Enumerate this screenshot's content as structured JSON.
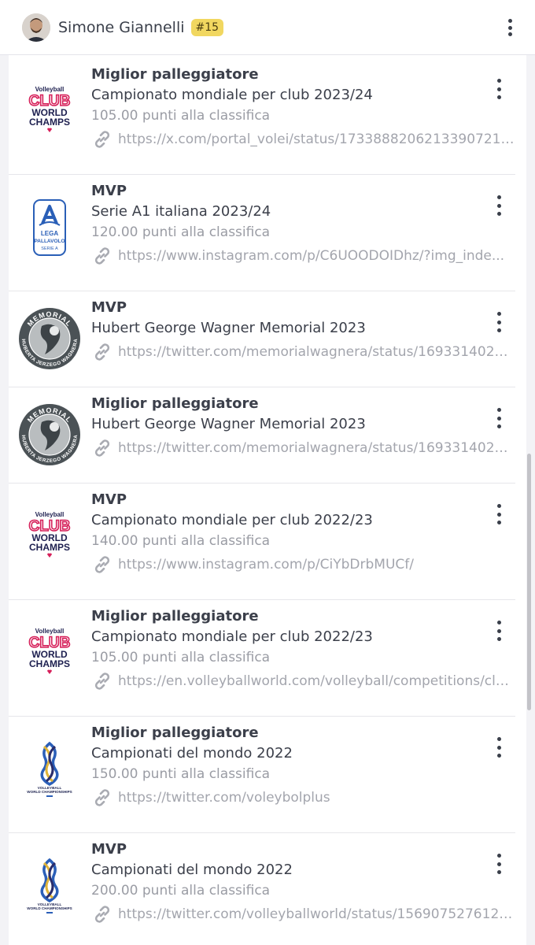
{
  "header": {
    "name": "Simone Giannelli",
    "rank": "#15"
  },
  "awards": [
    {
      "title": "Miglior palleggiatore",
      "competition": "Campionato mondiale per club 2023/24",
      "points": "105.00 punti alla classifica",
      "link": "https://x.com/portal_volei/status/1733888206213390721?t...",
      "logo": "club-world-champs"
    },
    {
      "title": "MVP",
      "competition": "Serie A1 italiana 2023/24",
      "points": "120.00 punti alla classifica",
      "link": "https://www.instagram.com/p/C6UOODOIDhz/?img_inde...",
      "logo": "lega-pallavolo-serie-a"
    },
    {
      "title": "MVP",
      "competition": "Hubert George Wagner Memorial 2023",
      "points": "",
      "link": "https://twitter.com/memorialwagnera/status/1693314020...",
      "logo": "wagner-memorial"
    },
    {
      "title": "Miglior palleggiatore",
      "competition": "Hubert George Wagner Memorial 2023",
      "points": "",
      "link": "https://twitter.com/memorialwagnera/status/1693314020...",
      "logo": "wagner-memorial"
    },
    {
      "title": "MVP",
      "competition": "Campionato mondiale per club 2022/23",
      "points": "140.00 punti alla classifica",
      "link": "https://www.instagram.com/p/CiYbDrbMUCf/",
      "logo": "club-world-champs"
    },
    {
      "title": "Miglior palleggiatore",
      "competition": "Campionato mondiale per club 2022/23",
      "points": "105.00 punti alla classifica",
      "link": "https://en.volleyballworld.com/volleyball/competitions/clu...",
      "logo": "club-world-champs"
    },
    {
      "title": "Miglior palleggiatore",
      "competition": "Campionati del mondo 2022",
      "points": "150.00 punti alla classifica",
      "link": "https://twitter.com/voleybolplus",
      "logo": "volleyball-world-championships"
    },
    {
      "title": "MVP",
      "competition": "Campionati del mondo 2022",
      "points": "200.00 punti alla classifica",
      "link": "https://twitter.com/volleyballworld/status/15690752761218...",
      "logo": "volleyball-world-championships"
    }
  ],
  "logo_text": {
    "club_world_champs": [
      "Volleyball",
      "CLUB",
      "WORLD",
      "CHAMPS"
    ],
    "lega": [
      "LEGA",
      "PALLAVOLO",
      "SERIE A"
    ],
    "memorial_top": "MEMORIAL",
    "memorial_bottom": "HUBERTA JERZEGO WAGNERA",
    "vwc": [
      "VOLLEYBALL",
      "WORLD CHAMPIONSHIPS"
    ]
  },
  "colors": {
    "accent_badge": "#f1d760",
    "club_pink": "#d6205a",
    "club_navy": "#1d1f4f",
    "lega_blue": "#2a5fb7",
    "memorial_gray": "#4b5256"
  }
}
